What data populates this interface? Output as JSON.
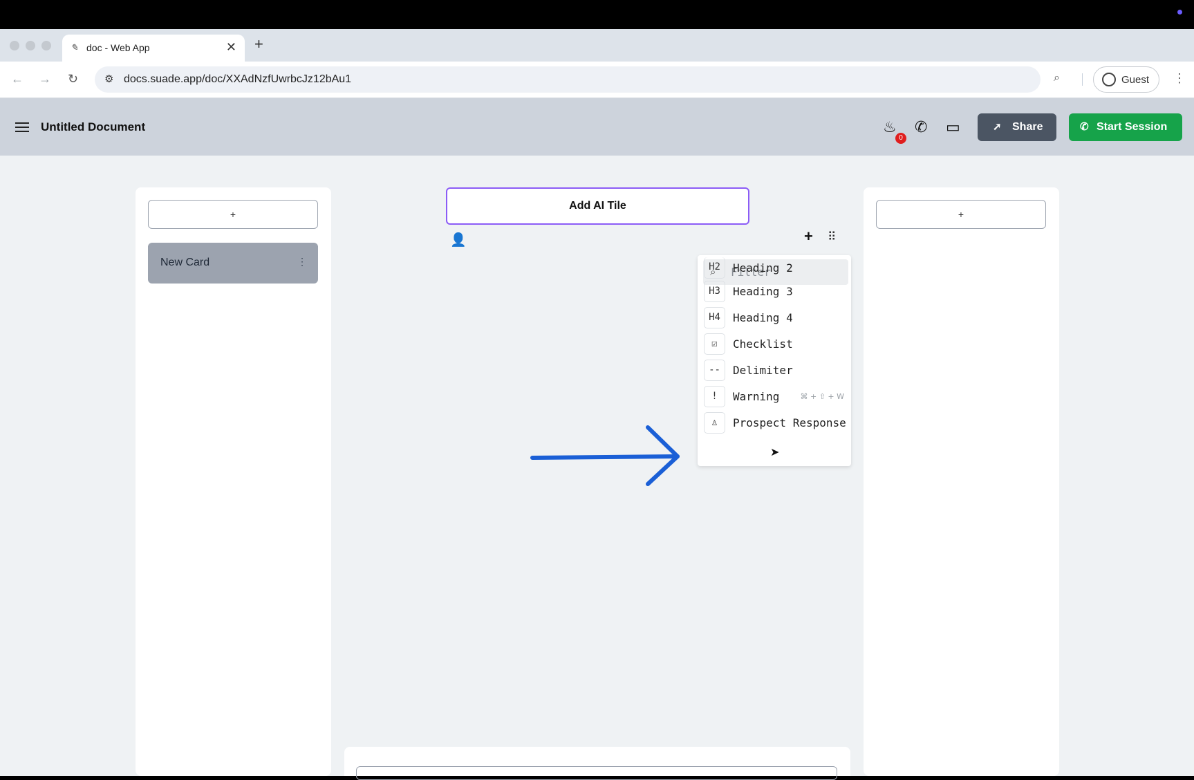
{
  "browser": {
    "tab_title": "doc - Web App",
    "tab_close": "✕",
    "new_tab": "+",
    "url": "docs.suade.app/doc/XXAdNzfUwrbcJz12bAu1",
    "profile_label": "Guest"
  },
  "app": {
    "document_title": "Untitled Document",
    "notification_count": "0",
    "share_label": "Share",
    "start_session_label": "Start Session"
  },
  "left_column": {
    "add_label": "+",
    "cards": [
      {
        "label": "New Card",
        "menu": "⋮"
      }
    ]
  },
  "center": {
    "ai_tile_label": "Add AI Tile",
    "add_block": "+",
    "drag_handle": "⠿"
  },
  "right_column": {
    "add_label": "+"
  },
  "block_menu": {
    "filter_placeholder": "Filter",
    "items": [
      {
        "icon_text": "H2",
        "label": "Heading 2",
        "shortcut": ""
      },
      {
        "icon_text": "H3",
        "label": "Heading 3",
        "shortcut": ""
      },
      {
        "icon_text": "H4",
        "label": "Heading 4",
        "shortcut": ""
      },
      {
        "icon_text": "☑",
        "label": "Checklist",
        "shortcut": ""
      },
      {
        "icon_text": "--",
        "label": "Delimiter",
        "shortcut": ""
      },
      {
        "icon_text": "!",
        "label": "Warning",
        "shortcut": "⌘ + ⇧ + W"
      },
      {
        "icon_text": "♙",
        "label": "Prospect Response",
        "shortcut": ""
      }
    ]
  },
  "colors": {
    "share_bg": "#4b5563",
    "start_session_bg": "#16a34a",
    "ai_tile_border": "#8b5cf6",
    "annotation_arrow": "#1a5fd6",
    "badge_bg": "#e01e1e"
  }
}
